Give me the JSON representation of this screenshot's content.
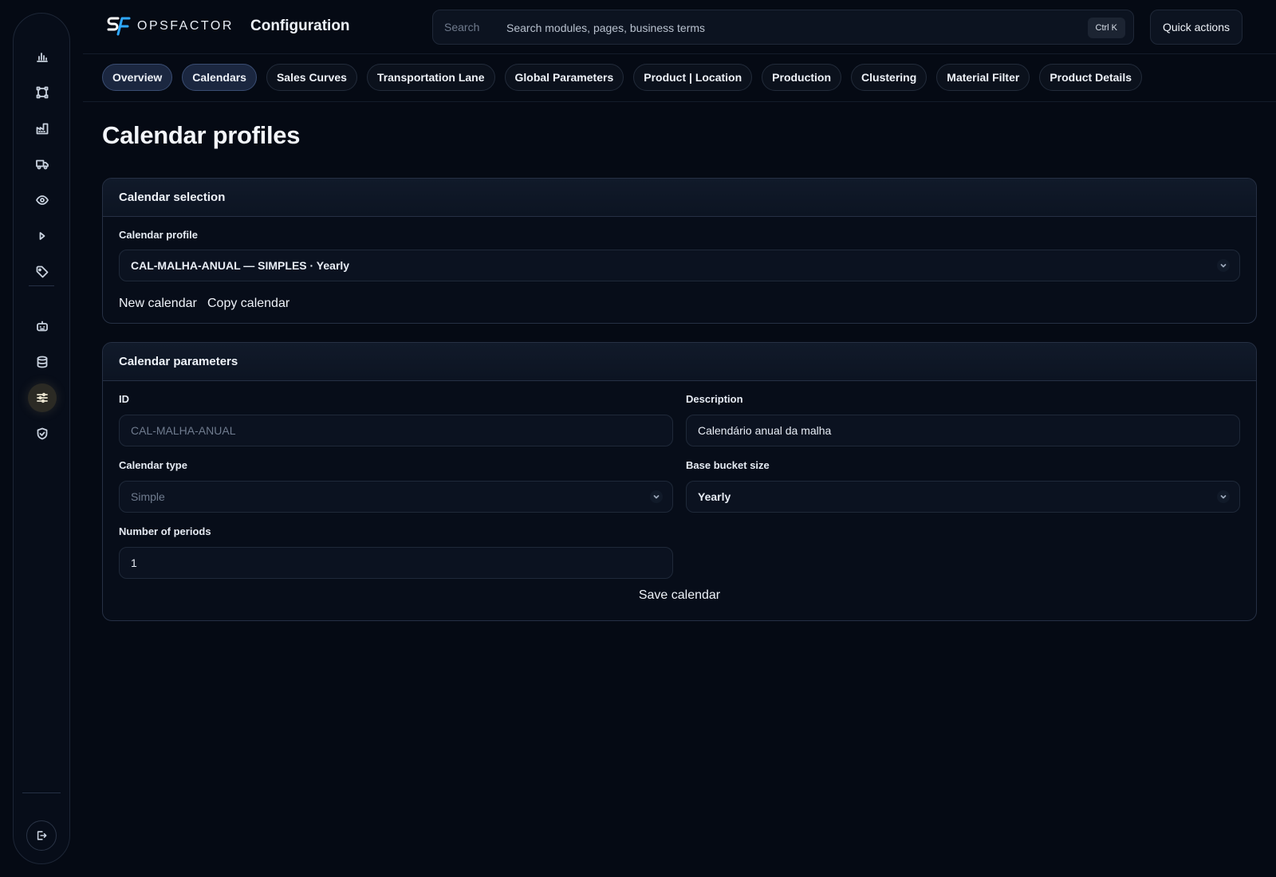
{
  "brand": {
    "logo_text": "OPSFACTOR",
    "accent_color": "#2fa8ff"
  },
  "header": {
    "app_title": "Configuration",
    "search_label": "Search",
    "search_placeholder": "Search modules, pages, business terms",
    "search_shortcut": "Ctrl K",
    "quick_actions_label": "Quick actions"
  },
  "sidebar": {
    "items": [
      {
        "icon": "bar-chart-icon"
      },
      {
        "icon": "network-icon"
      },
      {
        "icon": "factory-icon"
      },
      {
        "icon": "truck-icon"
      },
      {
        "icon": "eye-icon"
      },
      {
        "icon": "play-icon"
      },
      {
        "icon": "tag-icon"
      },
      {
        "icon": "robot-icon"
      },
      {
        "icon": "database-icon"
      },
      {
        "icon": "sliders-icon",
        "active": true
      },
      {
        "icon": "shield-check-icon"
      }
    ],
    "logout_icon": "logout-icon"
  },
  "tabs": [
    {
      "label": "Overview",
      "active": true
    },
    {
      "label": "Calendars",
      "active": true
    },
    {
      "label": "Sales Curves"
    },
    {
      "label": "Transportation Lane"
    },
    {
      "label": "Global Parameters"
    },
    {
      "label": "Product | Location"
    },
    {
      "label": "Production"
    },
    {
      "label": "Clustering"
    },
    {
      "label": "Material Filter"
    },
    {
      "label": "Product Details"
    }
  ],
  "page": {
    "title": "Calendar profiles"
  },
  "calendar_selection": {
    "title": "Calendar selection",
    "profile_label": "Calendar profile",
    "profile_value": "CAL-MALHA-ANUAL — SIMPLES · Yearly",
    "new_label": "New calendar",
    "copy_label": "Copy calendar"
  },
  "calendar_parameters": {
    "title": "Calendar parameters",
    "id_label": "ID",
    "id_value": "CAL-MALHA-ANUAL",
    "description_label": "Description",
    "description_value": "Calendário anual da malha",
    "type_label": "Calendar type",
    "type_value": "Simple",
    "bucket_label": "Base bucket size",
    "bucket_value": "Yearly",
    "periods_label": "Number of periods",
    "periods_value": "1",
    "save_label": "Save calendar"
  }
}
